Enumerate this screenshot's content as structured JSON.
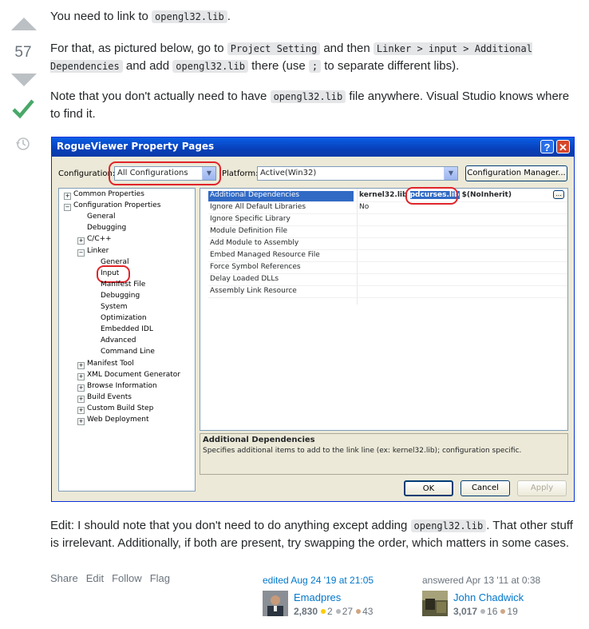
{
  "vote": {
    "count": "57"
  },
  "answer": {
    "p1_pre": "You need to link to ",
    "p1_code": "opengl32.lib",
    "p1_post": ".",
    "p2_a": "For that, as pictured below, go to ",
    "p2_code1": "Project Setting",
    "p2_b": " and then ",
    "p2_code2": "Linker > input > Additional Dependencies",
    "p2_c": " and add ",
    "p2_code3": "opengl32.lib",
    "p2_d": " there (use ",
    "p2_code4": ";",
    "p2_e": " to separate different libs).",
    "p3_a": "Note that you don't actually need to have ",
    "p3_code": "opengl32.lib",
    "p3_b": " file anywhere. Visual Studio knows where to find it.",
    "p4_a": "Edit: I should note that you don't need to do anything except adding ",
    "p4_code": "opengl32.lib",
    "p4_b": ". That other stuff is irrelevant. Additionally, if both are present, try swapping the order, which matters in some cases."
  },
  "dialog": {
    "title": "RogueViewer Property Pages",
    "help": "?",
    "close": "✕",
    "configuration_label": "Configuration:",
    "configuration_value": "All Configurations",
    "platform_label": "Platform:",
    "platform_value": "Active(Win32)",
    "config_manager": "Configuration Manager...",
    "tree": [
      {
        "label": "Common Properties",
        "toggle": "+"
      },
      {
        "label": "Configuration Properties",
        "toggle": "−"
      },
      {
        "label": "General"
      },
      {
        "label": "Debugging"
      },
      {
        "label": "C/C++",
        "toggle": "+"
      },
      {
        "label": "Linker",
        "toggle": "−"
      },
      {
        "label": "General"
      },
      {
        "label": "Input"
      },
      {
        "label": "Manifest File"
      },
      {
        "label": "Debugging"
      },
      {
        "label": "System"
      },
      {
        "label": "Optimization"
      },
      {
        "label": "Embedded IDL"
      },
      {
        "label": "Advanced"
      },
      {
        "label": "Command Line"
      },
      {
        "label": "Manifest Tool",
        "toggle": "+"
      },
      {
        "label": "XML Document Generator",
        "toggle": "+"
      },
      {
        "label": "Browse Information",
        "toggle": "+"
      },
      {
        "label": "Build Events",
        "toggle": "+"
      },
      {
        "label": "Custom Build Step",
        "toggle": "+"
      },
      {
        "label": "Web Deployment",
        "toggle": "+"
      }
    ],
    "properties": [
      {
        "name": "Additional Dependencies",
        "v1": "kernel32.lib ",
        "v2": "pdcurses.lib",
        "v3": " $(NoInherit)"
      },
      {
        "name": "Ignore All Default Libraries",
        "v1": "No"
      },
      {
        "name": "Ignore Specific Library"
      },
      {
        "name": "Module Definition File"
      },
      {
        "name": "Add Module to Assembly"
      },
      {
        "name": "Embed Managed Resource File"
      },
      {
        "name": "Force Symbol References"
      },
      {
        "name": "Delay Loaded DLLs"
      },
      {
        "name": "Assembly Link Resource"
      }
    ],
    "ellipsis": "...",
    "desc_title": "Additional Dependencies",
    "desc_text": "Specifies additional items to add to the link line (ex: kernel32.lib); configuration specific.",
    "ok": "OK",
    "cancel": "Cancel",
    "apply": "Apply"
  },
  "footer": {
    "share": "Share",
    "edit": "Edit",
    "follow": "Follow",
    "flag": "Flag"
  },
  "edited": {
    "label": "edited Aug 24 '19 at 21:05",
    "user": "Emadpres",
    "rep": "2,830",
    "gold": "2",
    "silver": "27",
    "bronze": "43"
  },
  "answered": {
    "label": "answered Apr 13 '11 at 0:38",
    "user": "John Chadwick",
    "rep": "3,017",
    "silver": "16",
    "bronze": "19"
  },
  "colors": {
    "gold": "#ffcc01",
    "silver": "#b4b8bc",
    "bronze": "#d1a684",
    "accept": "#48a868"
  }
}
